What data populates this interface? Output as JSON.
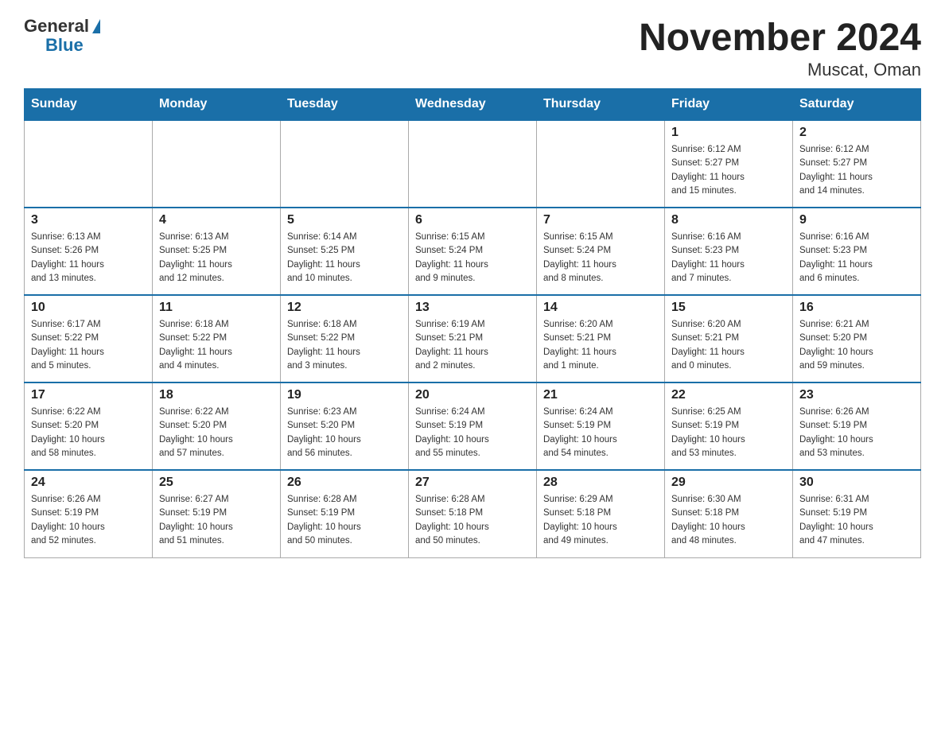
{
  "header": {
    "logo_general": "General",
    "logo_blue": "Blue",
    "title": "November 2024",
    "location": "Muscat, Oman"
  },
  "days_of_week": [
    "Sunday",
    "Monday",
    "Tuesday",
    "Wednesday",
    "Thursday",
    "Friday",
    "Saturday"
  ],
  "weeks": [
    [
      {
        "day": "",
        "info": ""
      },
      {
        "day": "",
        "info": ""
      },
      {
        "day": "",
        "info": ""
      },
      {
        "day": "",
        "info": ""
      },
      {
        "day": "",
        "info": ""
      },
      {
        "day": "1",
        "info": "Sunrise: 6:12 AM\nSunset: 5:27 PM\nDaylight: 11 hours\nand 15 minutes."
      },
      {
        "day": "2",
        "info": "Sunrise: 6:12 AM\nSunset: 5:27 PM\nDaylight: 11 hours\nand 14 minutes."
      }
    ],
    [
      {
        "day": "3",
        "info": "Sunrise: 6:13 AM\nSunset: 5:26 PM\nDaylight: 11 hours\nand 13 minutes."
      },
      {
        "day": "4",
        "info": "Sunrise: 6:13 AM\nSunset: 5:25 PM\nDaylight: 11 hours\nand 12 minutes."
      },
      {
        "day": "5",
        "info": "Sunrise: 6:14 AM\nSunset: 5:25 PM\nDaylight: 11 hours\nand 10 minutes."
      },
      {
        "day": "6",
        "info": "Sunrise: 6:15 AM\nSunset: 5:24 PM\nDaylight: 11 hours\nand 9 minutes."
      },
      {
        "day": "7",
        "info": "Sunrise: 6:15 AM\nSunset: 5:24 PM\nDaylight: 11 hours\nand 8 minutes."
      },
      {
        "day": "8",
        "info": "Sunrise: 6:16 AM\nSunset: 5:23 PM\nDaylight: 11 hours\nand 7 minutes."
      },
      {
        "day": "9",
        "info": "Sunrise: 6:16 AM\nSunset: 5:23 PM\nDaylight: 11 hours\nand 6 minutes."
      }
    ],
    [
      {
        "day": "10",
        "info": "Sunrise: 6:17 AM\nSunset: 5:22 PM\nDaylight: 11 hours\nand 5 minutes."
      },
      {
        "day": "11",
        "info": "Sunrise: 6:18 AM\nSunset: 5:22 PM\nDaylight: 11 hours\nand 4 minutes."
      },
      {
        "day": "12",
        "info": "Sunrise: 6:18 AM\nSunset: 5:22 PM\nDaylight: 11 hours\nand 3 minutes."
      },
      {
        "day": "13",
        "info": "Sunrise: 6:19 AM\nSunset: 5:21 PM\nDaylight: 11 hours\nand 2 minutes."
      },
      {
        "day": "14",
        "info": "Sunrise: 6:20 AM\nSunset: 5:21 PM\nDaylight: 11 hours\nand 1 minute."
      },
      {
        "day": "15",
        "info": "Sunrise: 6:20 AM\nSunset: 5:21 PM\nDaylight: 11 hours\nand 0 minutes."
      },
      {
        "day": "16",
        "info": "Sunrise: 6:21 AM\nSunset: 5:20 PM\nDaylight: 10 hours\nand 59 minutes."
      }
    ],
    [
      {
        "day": "17",
        "info": "Sunrise: 6:22 AM\nSunset: 5:20 PM\nDaylight: 10 hours\nand 58 minutes."
      },
      {
        "day": "18",
        "info": "Sunrise: 6:22 AM\nSunset: 5:20 PM\nDaylight: 10 hours\nand 57 minutes."
      },
      {
        "day": "19",
        "info": "Sunrise: 6:23 AM\nSunset: 5:20 PM\nDaylight: 10 hours\nand 56 minutes."
      },
      {
        "day": "20",
        "info": "Sunrise: 6:24 AM\nSunset: 5:19 PM\nDaylight: 10 hours\nand 55 minutes."
      },
      {
        "day": "21",
        "info": "Sunrise: 6:24 AM\nSunset: 5:19 PM\nDaylight: 10 hours\nand 54 minutes."
      },
      {
        "day": "22",
        "info": "Sunrise: 6:25 AM\nSunset: 5:19 PM\nDaylight: 10 hours\nand 53 minutes."
      },
      {
        "day": "23",
        "info": "Sunrise: 6:26 AM\nSunset: 5:19 PM\nDaylight: 10 hours\nand 53 minutes."
      }
    ],
    [
      {
        "day": "24",
        "info": "Sunrise: 6:26 AM\nSunset: 5:19 PM\nDaylight: 10 hours\nand 52 minutes."
      },
      {
        "day": "25",
        "info": "Sunrise: 6:27 AM\nSunset: 5:19 PM\nDaylight: 10 hours\nand 51 minutes."
      },
      {
        "day": "26",
        "info": "Sunrise: 6:28 AM\nSunset: 5:19 PM\nDaylight: 10 hours\nand 50 minutes."
      },
      {
        "day": "27",
        "info": "Sunrise: 6:28 AM\nSunset: 5:18 PM\nDaylight: 10 hours\nand 50 minutes."
      },
      {
        "day": "28",
        "info": "Sunrise: 6:29 AM\nSunset: 5:18 PM\nDaylight: 10 hours\nand 49 minutes."
      },
      {
        "day": "29",
        "info": "Sunrise: 6:30 AM\nSunset: 5:18 PM\nDaylight: 10 hours\nand 48 minutes."
      },
      {
        "day": "30",
        "info": "Sunrise: 6:31 AM\nSunset: 5:19 PM\nDaylight: 10 hours\nand 47 minutes."
      }
    ]
  ]
}
